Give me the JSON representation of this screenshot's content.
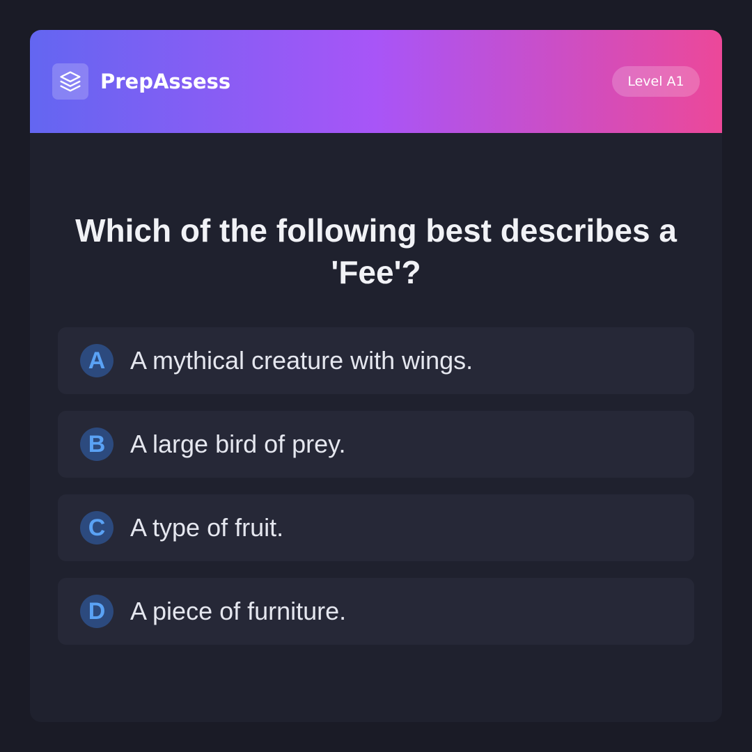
{
  "app": {
    "brand": "PrepAssess",
    "logo_icon": "layers-icon",
    "level_badge": "Level A1"
  },
  "question": {
    "text": "Which of the following best describes a 'Fee'?"
  },
  "options": [
    {
      "letter": "A",
      "text": "A mythical creature with wings."
    },
    {
      "letter": "B",
      "text": "A large bird of prey."
    },
    {
      "letter": "C",
      "text": "A type of fruit."
    },
    {
      "letter": "D",
      "text": "A piece of furniture."
    }
  ],
  "colors": {
    "page_background": "#1a1b26",
    "card_background": "#1f212e",
    "option_background": "#262837",
    "header_gradient": [
      "#6366f1",
      "#a855f7",
      "#ec4899"
    ],
    "letter_badge_background": "#2c4a7e",
    "letter_badge_text": "#5aa2f5"
  }
}
